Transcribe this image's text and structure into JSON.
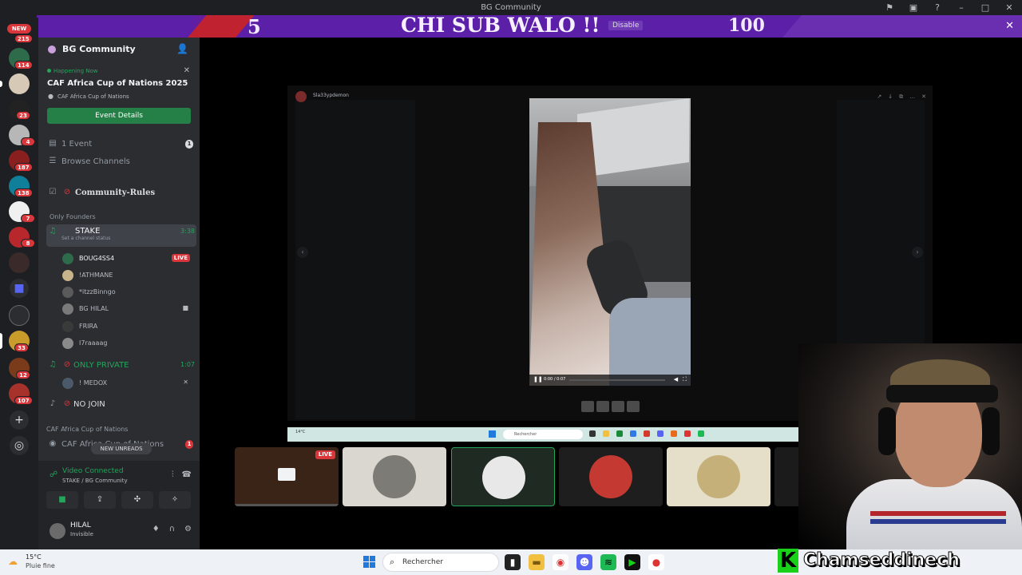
{
  "window": {
    "title": "BG Community"
  },
  "stream_banner": {
    "left_number": "5",
    "title": "CHI SUB WALO !!",
    "right_number": "100",
    "disable_label": "Disable"
  },
  "server_rail": {
    "new_label": "NEW",
    "badges": [
      "215",
      "114",
      "",
      "23",
      "4",
      "187",
      "138",
      "7",
      "8",
      "",
      "33",
      "12",
      "107"
    ]
  },
  "server": {
    "name": "BG Community"
  },
  "event": {
    "status": "Happening Now",
    "title": "CAF Africa Cup of Nations 2025",
    "location": "CAF Africa Cup of Nations",
    "button": "Event Details"
  },
  "channels": {
    "events_label": "1 Event",
    "events_count": "1",
    "browse_label": "Browse Channels",
    "rules_label": "Community-Rules",
    "category_founders": "Only Founders",
    "stake": {
      "label": "STAKE",
      "time": "3:38",
      "status_placeholder": "Set a channel status"
    },
    "stake_users": [
      {
        "name": "BOUG4SS4",
        "live": "LIVE"
      },
      {
        "name": "!ATHMANE"
      },
      {
        "name": "*itzzBinngo"
      },
      {
        "name": "BG HILAL"
      },
      {
        "name": "FRIRA"
      },
      {
        "name": "I7raaaag"
      }
    ],
    "private": {
      "label": "ONLY PRIVATE",
      "time": "1:07"
    },
    "private_users": [
      {
        "name": "! MEDOX"
      }
    ],
    "no_join": "NO JOIN",
    "category_caf": "CAF Africa Cup of Nations",
    "caf_channel": "CAF Africa Cup of Nations",
    "caf_badge": "1",
    "new_unreads": "NEW UNREADS"
  },
  "voice": {
    "status": "Video Connected",
    "location": "STAKE / BG Community"
  },
  "user": {
    "name": "HILAL",
    "status": "Invisible"
  },
  "stream": {
    "poster": "Sla33ypdemon",
    "video_time": "0:00 / 0:07",
    "inner_search": "Rechercher",
    "inner_weather": "14°C"
  },
  "tiles": {
    "live_label": "LIVE"
  },
  "watermark": {
    "letter": "K",
    "text": "Chamseddinech"
  },
  "taskbar": {
    "temperature": "15°C",
    "condition": "Pluie fine",
    "search_placeholder": "Rechercher"
  },
  "colors": {
    "banner": "#5c1fa8",
    "discord_green": "#23a55a",
    "badge_red": "#da373c",
    "sidebar": "#2b2d31"
  }
}
